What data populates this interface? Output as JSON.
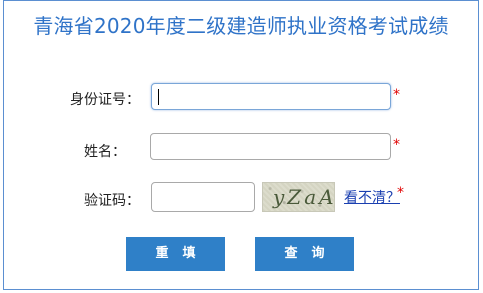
{
  "title": "青海省2020年度二级建造师执业资格考试成绩",
  "form": {
    "id_label": "身份证号：",
    "id_value": "",
    "name_label": "姓名：",
    "name_value": "",
    "captcha_label": "验证码：",
    "captcha_value": "",
    "captcha_image_text": "yZaA",
    "refresh_link": "看不清？",
    "required_mark": "*"
  },
  "buttons": {
    "reset": "重填",
    "query": "查询"
  },
  "colors": {
    "title": "#2f73c8",
    "border": "#5b8fd1",
    "button": "#2f80c8",
    "required": "#e00000",
    "link": "#1a3fb0"
  }
}
